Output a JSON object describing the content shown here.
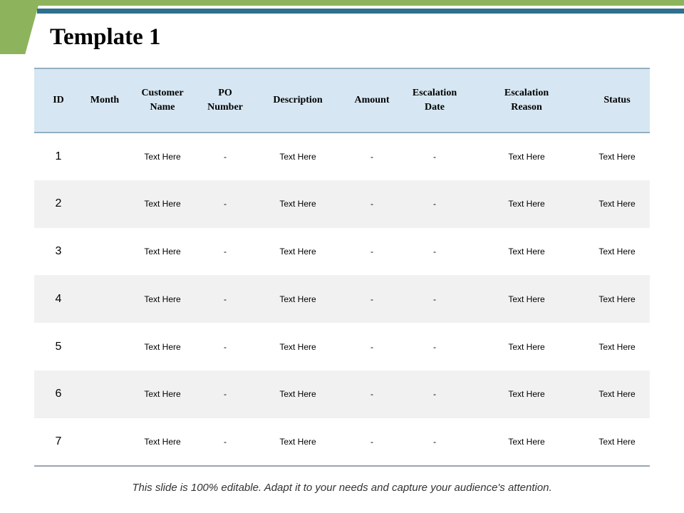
{
  "slide": {
    "title": "Template 1",
    "footer": "This slide is 100% editable. Adapt it to your needs and capture your audience's attention."
  },
  "table": {
    "headers": [
      [
        "ID"
      ],
      [
        "Month"
      ],
      [
        "Customer",
        "Name"
      ],
      [
        "PO",
        "Number"
      ],
      [
        "Description"
      ],
      [
        "Amount"
      ],
      [
        "Escalation",
        "Date"
      ],
      [
        "Escalation",
        "Reason"
      ],
      [
        "Status"
      ]
    ],
    "rows": [
      [
        "1",
        "",
        "Text Here",
        "-",
        "Text Here",
        "-",
        "-",
        "Text Here",
        "Text Here"
      ],
      [
        "2",
        "",
        "Text Here",
        "-",
        "Text Here",
        "-",
        "-",
        "Text Here",
        "Text Here"
      ],
      [
        "3",
        "",
        "Text Here",
        "-",
        "Text Here",
        "-",
        "-",
        "Text Here",
        "Text Here"
      ],
      [
        "4",
        "",
        "Text Here",
        "-",
        "Text Here",
        "-",
        "-",
        "Text Here",
        "Text Here"
      ],
      [
        "5",
        "",
        "Text Here",
        "-",
        "Text Here",
        "-",
        "-",
        "Text Here",
        "Text Here"
      ],
      [
        "6",
        "",
        "Text Here",
        "-",
        "Text Here",
        "-",
        "-",
        "Text Here",
        "Text Here"
      ],
      [
        "7",
        "",
        "Text Here",
        "-",
        "Text Here",
        "-",
        "-",
        "Text Here",
        "Text Here"
      ]
    ]
  },
  "colors": {
    "accent_green": "#8db45c",
    "accent_blue": "#2f6f8f",
    "header_fill": "#d6e7f3",
    "stripe_fill": "#f1f1f1"
  }
}
